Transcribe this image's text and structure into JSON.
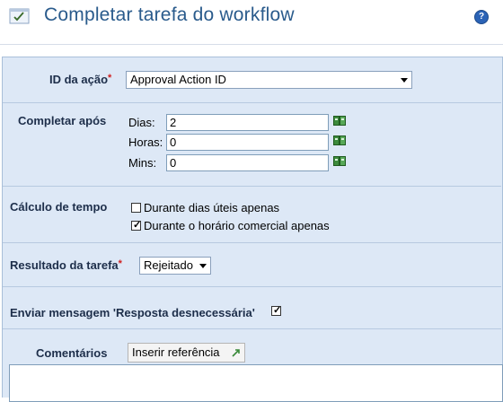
{
  "header": {
    "title": "Completar tarefa do workflow",
    "help_glyph": "?"
  },
  "action": {
    "label": "ID da ação",
    "required_mark": "*",
    "selected": "Approval Action ID"
  },
  "complete_after": {
    "label": "Completar após",
    "rows": [
      {
        "label": "Dias:",
        "value": "2"
      },
      {
        "label": "Horas:",
        "value": "0"
      },
      {
        "label": "Mins:",
        "value": "0"
      }
    ]
  },
  "time_calc": {
    "label": "Cálculo de tempo",
    "options": [
      {
        "label": "Durante dias úteis apenas",
        "checked": false
      },
      {
        "label": "Durante o horário comercial apenas",
        "checked": true
      }
    ]
  },
  "task_result": {
    "label": "Resultado da tarefa",
    "required_mark": "*",
    "selected": "Rejeitado"
  },
  "send_message": {
    "label": "Enviar mensagem 'Resposta desnecessária'",
    "checked": true
  },
  "comments": {
    "label": "Comentários",
    "insert_button": "Inserir referência",
    "value": ""
  },
  "icons": {
    "header": "checklist-icon",
    "picker": "book-picker-icon",
    "insert": "arrow-up-right-icon"
  },
  "colors": {
    "title": "#2a5b8c",
    "panel": "#dde8f6",
    "label": "#1d2e4a",
    "required": "#d02020"
  }
}
